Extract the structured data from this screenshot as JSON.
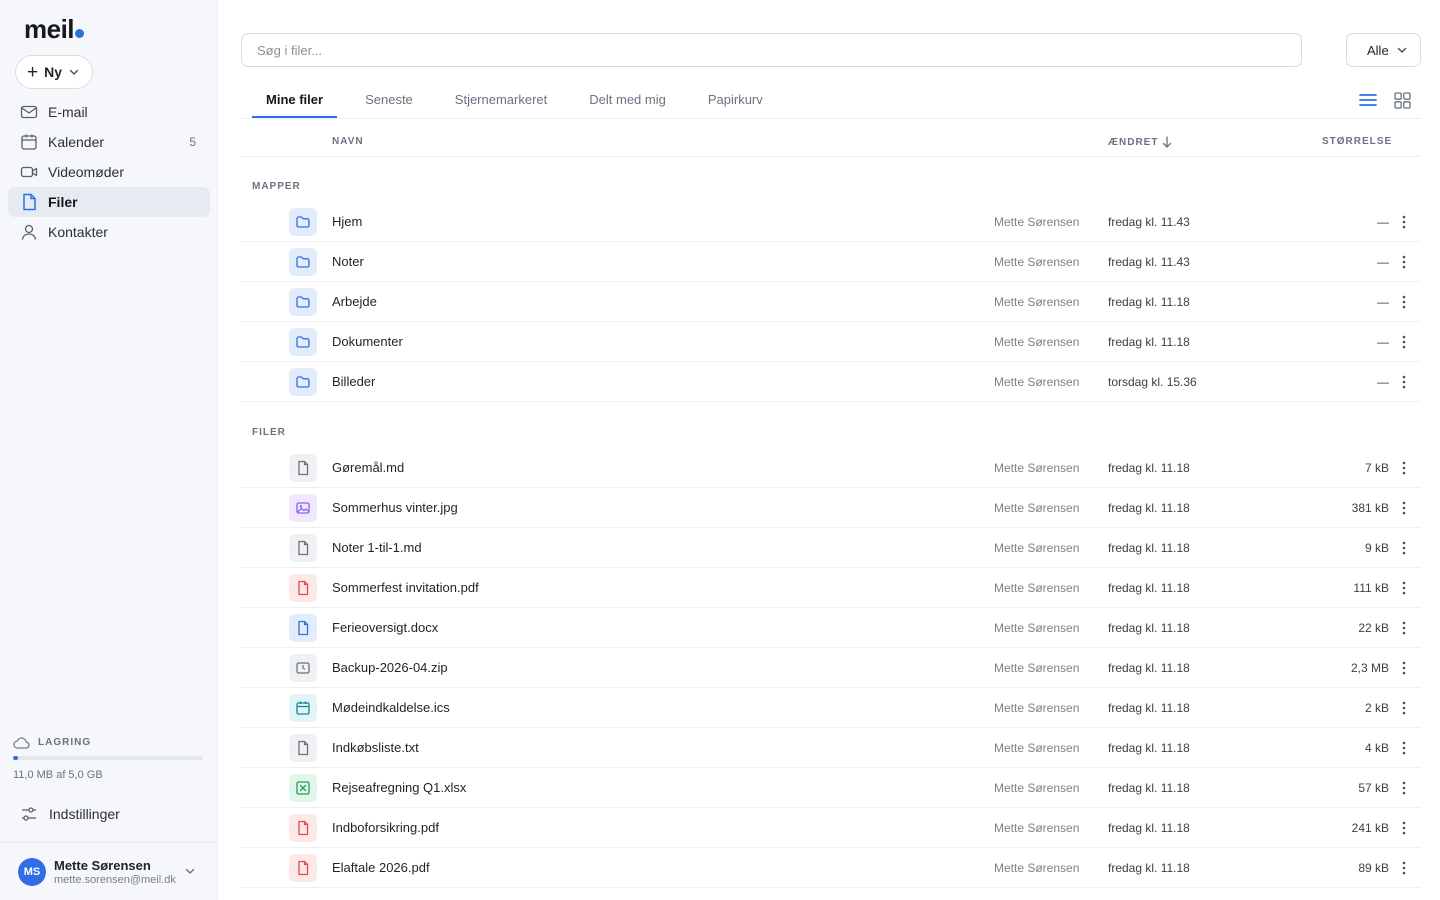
{
  "app": {
    "logo": "meil"
  },
  "sidebar": {
    "new_label": "Ny",
    "items": [
      {
        "label": "E-mail",
        "icon": "mail-icon",
        "count": ""
      },
      {
        "label": "Kalender",
        "icon": "calendar-icon",
        "count": "5"
      },
      {
        "label": "Videomøder",
        "icon": "video-icon",
        "count": ""
      },
      {
        "label": "Filer",
        "icon": "file-icon",
        "count": "",
        "active": true
      },
      {
        "label": "Kontakter",
        "icon": "user-icon",
        "count": ""
      }
    ],
    "storage": {
      "label": "LAGRING",
      "text": "11,0 MB af 5,0 GB",
      "used_fraction": 0.0022
    },
    "settings_label": "Indstillinger",
    "user": {
      "initials": "MS",
      "name": "Mette Sørensen",
      "email": "mette.sorensen@meil.dk"
    }
  },
  "search": {
    "placeholder": "Søg i filer..."
  },
  "filter": {
    "selected": "Alle"
  },
  "tabs": [
    "Mine filer",
    "Seneste",
    "Stjernemarkeret",
    "Delt med mig",
    "Papirkurv"
  ],
  "columns": {
    "name": "NAVN",
    "modified": "ÆNDRET",
    "size": "STØRRELSE"
  },
  "sections": {
    "folders": "MAPPER",
    "files": "FILER"
  },
  "folders": [
    {
      "name": "Hjem",
      "owner": "Mette Sørensen",
      "modified": "fredag kl. 11.43",
      "size": "—"
    },
    {
      "name": "Noter",
      "owner": "Mette Sørensen",
      "modified": "fredag kl. 11.43",
      "size": "—"
    },
    {
      "name": "Arbejde",
      "owner": "Mette Sørensen",
      "modified": "fredag kl. 11.18",
      "size": "—"
    },
    {
      "name": "Dokumenter",
      "owner": "Mette Sørensen",
      "modified": "fredag kl. 11.18",
      "size": "—"
    },
    {
      "name": "Billeder",
      "owner": "Mette Sørensen",
      "modified": "torsdag kl. 15.36",
      "size": "—"
    }
  ],
  "files": [
    {
      "name": "Gøremål.md",
      "type": "doc",
      "owner": "Mette Sørensen",
      "modified": "fredag kl. 11.18",
      "size": "7 kB"
    },
    {
      "name": "Sommerhus vinter.jpg",
      "type": "image",
      "owner": "Mette Sørensen",
      "modified": "fredag kl. 11.18",
      "size": "381 kB"
    },
    {
      "name": "Noter 1-til-1.md",
      "type": "doc",
      "owner": "Mette Sørensen",
      "modified": "fredag kl. 11.18",
      "size": "9 kB"
    },
    {
      "name": "Sommerfest invitation.pdf",
      "type": "pdf",
      "owner": "Mette Sørensen",
      "modified": "fredag kl. 11.18",
      "size": "111 kB"
    },
    {
      "name": "Ferieoversigt.docx",
      "type": "word",
      "owner": "Mette Sørensen",
      "modified": "fredag kl. 11.18",
      "size": "22 kB"
    },
    {
      "name": "Backup-2026-04.zip",
      "type": "archive",
      "owner": "Mette Sørensen",
      "modified": "fredag kl. 11.18",
      "size": "2,3 MB"
    },
    {
      "name": "Mødeindkaldelse.ics",
      "type": "calendar",
      "owner": "Mette Sørensen",
      "modified": "fredag kl. 11.18",
      "size": "2 kB"
    },
    {
      "name": "Indkøbsliste.txt",
      "type": "doc",
      "owner": "Mette Sørensen",
      "modified": "fredag kl. 11.18",
      "size": "4 kB"
    },
    {
      "name": "Rejseafregning Q1.xlsx",
      "type": "sheet",
      "owner": "Mette Sørensen",
      "modified": "fredag kl. 11.18",
      "size": "57 kB"
    },
    {
      "name": "Indboforsikring.pdf",
      "type": "pdf",
      "owner": "Mette Sørensen",
      "modified": "fredag kl. 11.18",
      "size": "241 kB"
    },
    {
      "name": "Elaftale 2026.pdf",
      "type": "pdf",
      "owner": "Mette Sørensen",
      "modified": "fredag kl. 11.18",
      "size": "89 kB"
    }
  ],
  "colors": {
    "accent": "#2f6fe4",
    "folder_bg": "#e3ecfb",
    "pdf": "#e5484d",
    "sheet": "#1f9d55",
    "image": "#8b5cf6",
    "calendar": "#0e8a99"
  }
}
